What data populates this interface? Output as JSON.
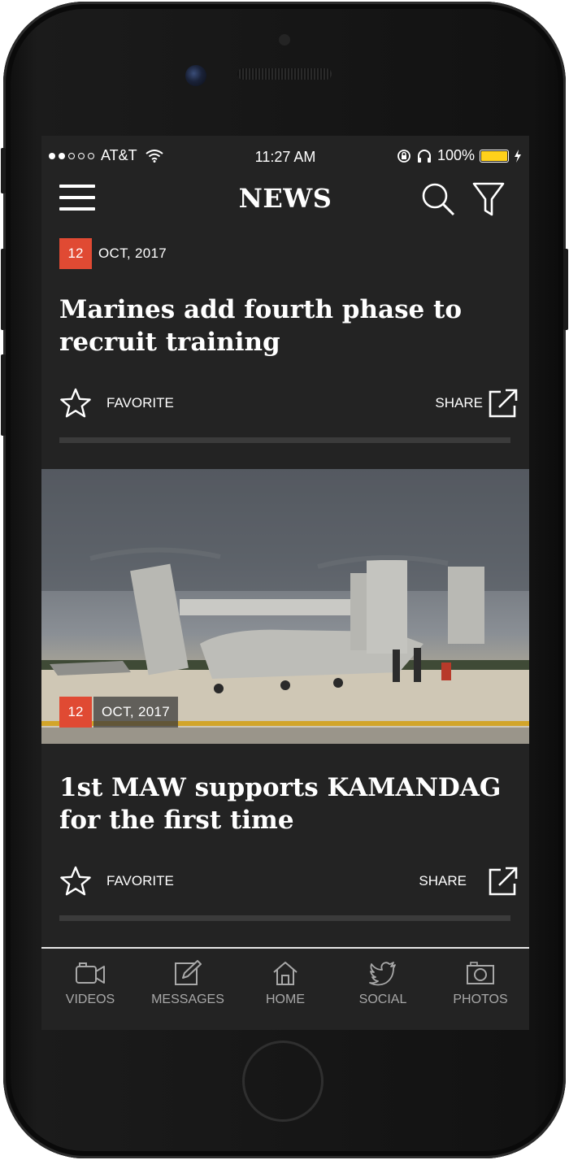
{
  "status_bar": {
    "carrier": "AT&T",
    "time": "11:27 AM",
    "battery": "100%"
  },
  "header": {
    "title": "NEWS",
    "icons": [
      "menu-icon",
      "search-icon",
      "filter-icon"
    ]
  },
  "articles": [
    {
      "day": "12",
      "date": "OCT, 2017",
      "headline": "Marines add fourth phase to recruit training",
      "favorite_label": "FAVORITE",
      "share_label": "SHARE"
    },
    {
      "day": "12",
      "date": "OCT, 2017",
      "headline": "1st MAW supports KAMANDAG for the first time",
      "favorite_label": "FAVORITE",
      "share_label": "SHARE"
    }
  ],
  "tabs": [
    {
      "label": "VIDEOS",
      "icon": "video-camera-icon"
    },
    {
      "label": "MESSAGES",
      "icon": "edit-icon"
    },
    {
      "label": "HOME",
      "icon": "home-icon"
    },
    {
      "label": "SOCIAL",
      "icon": "twitter-bird-icon"
    },
    {
      "label": "PHOTOS",
      "icon": "camera-icon"
    }
  ],
  "colors": {
    "accent": "#e04a33",
    "battery": "#ffd11a",
    "background": "#232323"
  }
}
